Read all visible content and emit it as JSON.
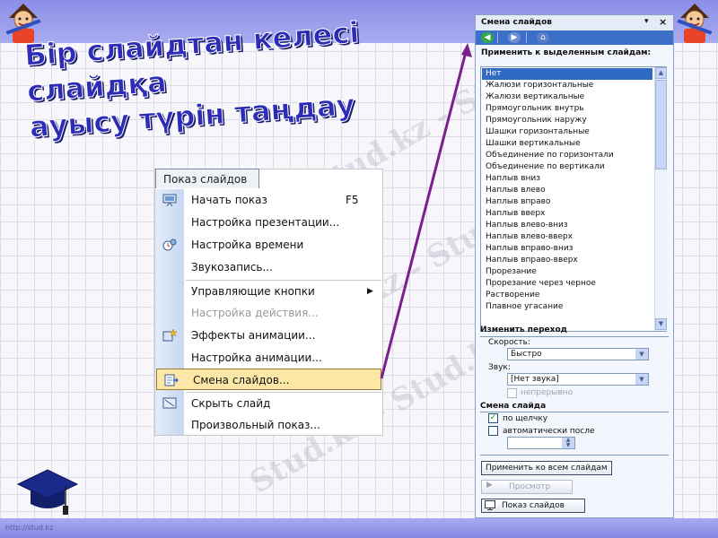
{
  "slide": {
    "title_line1": "Бір слайдтан келесі слайдқа",
    "title_line2": "ауысу түрін таңдау",
    "watermark": "Stud.kz - Stud.kz",
    "footer_url": "http://stud.kz"
  },
  "menu": {
    "header": "Показ слайдов",
    "items": [
      {
        "label": "Начать показ",
        "shortcut": "F5",
        "icon": "projector-icon"
      },
      {
        "label": "Настройка презентации..."
      },
      {
        "label": "Настройка времени",
        "icon": "timing-icon"
      },
      {
        "label": "Звукозапись..."
      },
      {
        "label": "Управляющие кнопки",
        "arrow": "▶"
      },
      {
        "label": "Настройка действия..."
      },
      {
        "label": "Эффекты анимации...",
        "icon": "star-effects-icon"
      },
      {
        "label": "Настройка анимации..."
      },
      {
        "label": "Смена слайдов...",
        "icon": "slide-transition-icon"
      },
      {
        "label": "Скрыть слайд",
        "icon": "hide-slide-icon"
      },
      {
        "label": "Произвольный показ..."
      }
    ]
  },
  "pane": {
    "title": "Смена слайдов",
    "pin_glyph": "▾",
    "close_glyph": "×",
    "apply_label": "Применить к выделенным слайдам:",
    "effects": [
      "Нет",
      "Жалюзи горизонтальные",
      "Жалюзи вертикальные",
      "Прямоугольник внутрь",
      "Прямоугольник наружу",
      "Шашки горизонтальные",
      "Шашки вертикальные",
      "Объединение по горизонтали",
      "Объединение по вертикали",
      "Наплыв вниз",
      "Наплыв влево",
      "Наплыв вправо",
      "Наплыв вверх",
      "Наплыв влево-вниз",
      "Наплыв влево-вверх",
      "Наплыв вправо-вниз",
      "Наплыв вправо-вверх",
      "Прорезание",
      "Прорезание через черное",
      "Растворение",
      "Плавное угасание"
    ],
    "modify_label": "Изменить переход",
    "speed_label": "Скорость:",
    "speed_value": "Быстро",
    "sound_label": "Звук:",
    "sound_value": "[Нет звука]",
    "loop_label": "непрерывно",
    "advance_label": "Смена слайда",
    "on_click_label": "по щелчку",
    "auto_label": "автоматически после",
    "apply_all_label": "Применить ко всем слайдам",
    "preview_label": "Просмотр",
    "slideshow_label": "Показ слайдов"
  },
  "colors": {
    "arrow": "#7a1f8c",
    "selection": "#316ac5",
    "menu_highlight": "#fde7a6"
  }
}
